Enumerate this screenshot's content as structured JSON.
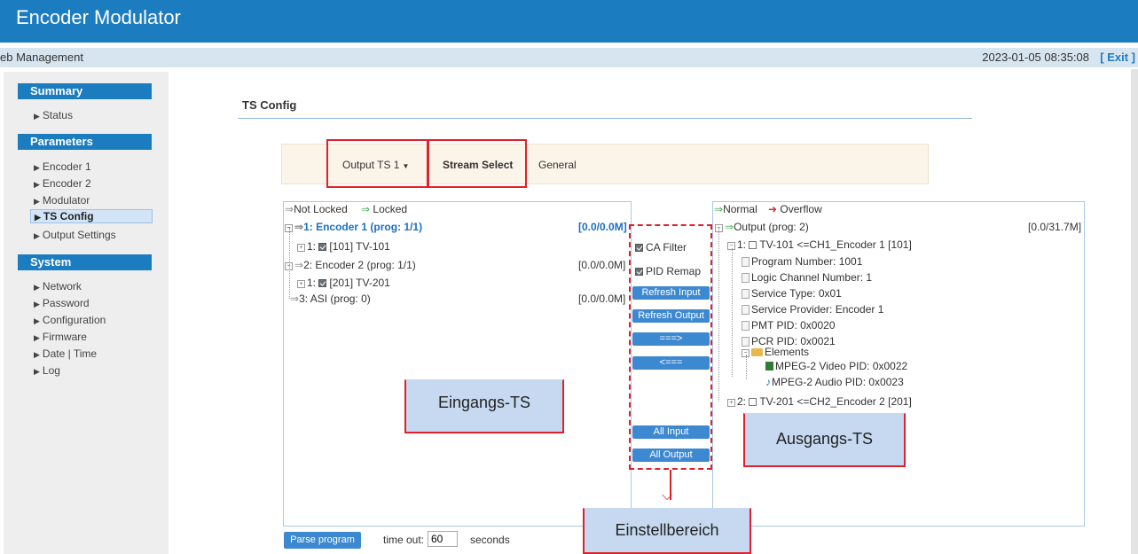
{
  "app": {
    "title": "Encoder Modulator",
    "subtitle": "eb Management",
    "datetime": "2023-01-05 08:35:08",
    "exit_label": "[ Exit ]"
  },
  "sidebar": {
    "summary": {
      "heading": "Summary",
      "items": [
        {
          "label": "Status"
        }
      ]
    },
    "parameters": {
      "heading": "Parameters",
      "items": [
        {
          "label": "Encoder 1"
        },
        {
          "label": "Encoder 2"
        },
        {
          "label": "Modulator"
        },
        {
          "label": "TS Config",
          "active": true
        },
        {
          "label": "Output Settings"
        }
      ]
    },
    "system": {
      "heading": "System",
      "items": [
        {
          "label": "Network"
        },
        {
          "label": "Password"
        },
        {
          "label": "Configuration"
        },
        {
          "label": "Firmware"
        },
        {
          "label": "Date | Time"
        },
        {
          "label": "Log"
        }
      ]
    }
  },
  "page": {
    "title": "TS Config"
  },
  "tabs": {
    "output_ts": "Output TS 1",
    "stream_select": "Stream Select",
    "general": "General"
  },
  "input_panel": {
    "legend_not_locked": "Not Locked",
    "legend_locked": "Locked",
    "rows": [
      {
        "label": "1: Encoder 1 (prog: 1/1)",
        "rate": "[0.0/0.0M]"
      },
      {
        "label": "[101] TV-101",
        "prefix": "1:"
      },
      {
        "label": "2: Encoder 2 (prog: 1/1)",
        "rate": "[0.0/0.0M]"
      },
      {
        "label": "[201] TV-201",
        "prefix": "1:"
      },
      {
        "label": "3: ASI (prog: 0)",
        "rate": "[0.0/0.0M]"
      }
    ]
  },
  "controls": {
    "ca_filter": "CA Filter",
    "pid_remap": "PID Remap",
    "refresh_input": "Refresh Input",
    "refresh_output": "Refresh Output",
    "add": "===>",
    "remove": "<===",
    "all_input": "All Input",
    "all_output": "All Output"
  },
  "output_panel": {
    "legend_normal": "Normal",
    "legend_overflow": "Overflow",
    "root": "Output (prog: 2)",
    "root_rate": "[0.0/31.7M]",
    "prog1": "TV-101 <=CH1_Encoder 1 [101]",
    "prog1_prefix": "1:",
    "details": [
      "Program Number: 1001",
      "Logic Channel Number: 1",
      "Service Type: 0x01",
      "Service Provider: Encoder 1",
      "PMT PID: 0x0020",
      "PCR PID: 0x0021"
    ],
    "elements": "Elements",
    "video": "MPEG-2 Video PID: 0x0022",
    "audio": "MPEG-2 Audio PID: 0x0023",
    "prog2": "TV-201 <=CH2_Encoder 2 [201]",
    "prog2_prefix": "2:"
  },
  "annotations": {
    "input": "Eingangs-TS",
    "output": "Ausgangs-TS",
    "settings": "Einstellbereich"
  },
  "footer": {
    "parse_button": "Parse program",
    "timeout_label": "time out:",
    "timeout_value": "60",
    "seconds": "seconds"
  },
  "colors": {
    "brand": "#1c7cc0",
    "annotation_red": "#e0202a",
    "annotation_fill": "#c6d9f1",
    "locked_green": "#4caf50",
    "overflow_red": "#d32f2f"
  }
}
